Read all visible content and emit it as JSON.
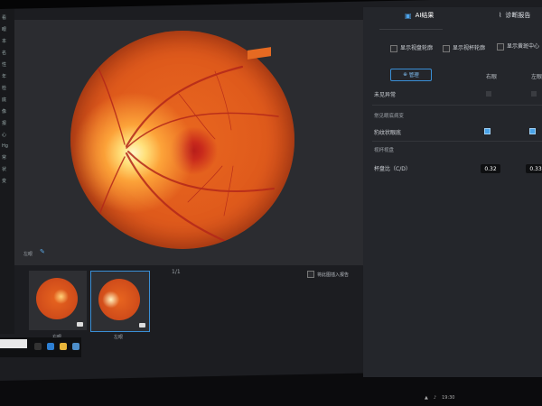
{
  "viewer": {
    "eye_caption": "左眼",
    "pager": "1/1",
    "report_checkbox_label": "将此图插入报告"
  },
  "thumbnails": [
    {
      "label": "右眼"
    },
    {
      "label": "左眼"
    }
  ],
  "tabs": {
    "ai_results": "AI结果",
    "diagnosis_report": "诊断报告"
  },
  "options": {
    "show_disc_outline": "显示视盘轮廓",
    "show_cup_outline": "显示视杯轮廓",
    "show_macula": "显示黄斑中心"
  },
  "manage_button": "管理",
  "columns": {
    "right_eye": "右眼",
    "left_eye": "左眼"
  },
  "findings": {
    "no_abnormality": "未见异常",
    "common_section": "常见眼底病变",
    "leopard_fundus": "豹纹状眼底",
    "quant_section": "视杯视盘",
    "cd_ratio_label": "杯盘比（C/D）",
    "cd_right": "0.32",
    "cd_left": "0.33"
  },
  "sidebar_chars": [
    "看",
    "眼",
    "本",
    "名",
    "性",
    "年",
    "检",
    "底",
    "像",
    "报",
    "心",
    "Hg",
    "常",
    "状",
    "变"
  ],
  "clock": "19:30",
  "colors": {
    "accent": "#3a8fd6",
    "fundus": "#e0601e"
  }
}
